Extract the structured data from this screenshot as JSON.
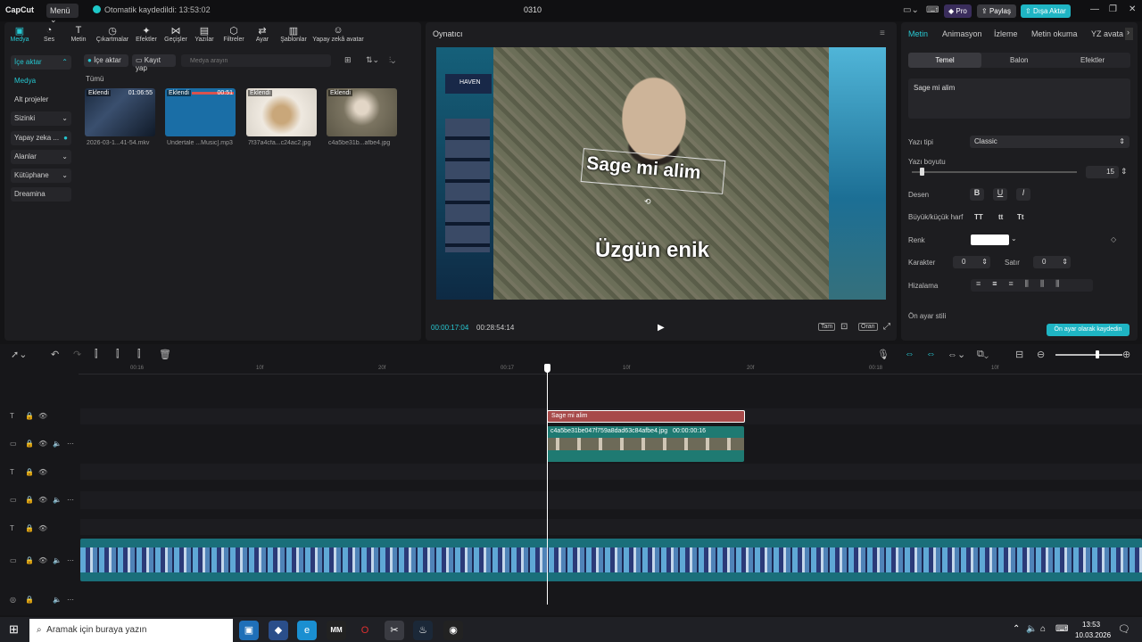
{
  "titlebar": {
    "app_name": "CapCut",
    "menu_label": "Menü",
    "autosave_text": "Otomatik kaydedildi: 13:53:02",
    "project_name": "0310",
    "pro_label": "Pro",
    "share_label": "Paylaş",
    "export_label": "Dışa Aktar"
  },
  "toolbar": {
    "items": [
      "Medya",
      "Ses",
      "Metin",
      "Çıkartmalar",
      "Efektler",
      "Geçişler",
      "Yazılar",
      "Filtreler",
      "Ayar",
      "Şablonlar",
      "Yapay zekâ avatar"
    ]
  },
  "sidebar": {
    "items": [
      "İçe aktar",
      "Medya",
      "Alt projeler",
      "Sizinki",
      "Yapay zeka ...",
      "Alanlar",
      "Kütüphane",
      "Dreamina"
    ]
  },
  "media": {
    "import_button": "İçe aktar",
    "record_button": "Kayıt yap",
    "search_placeholder": "Medya arayın",
    "filter_all": "Tümü",
    "cards": [
      {
        "badge": "Eklendi",
        "duration": "01:06:55",
        "name": "2026-03-1...41-54.mkv"
      },
      {
        "badge": "Eklendi",
        "duration": "00:51",
        "name": "Undertale ...Music].mp3"
      },
      {
        "badge": "Eklendi",
        "duration": "",
        "name": "7f37a4cfa...c24ac2.jpg"
      },
      {
        "badge": "Eklendi",
        "duration": "",
        "name": "c4a5be31b...afbe4.jpg"
      }
    ]
  },
  "player": {
    "title": "Oynatıcı",
    "caption_top": "Sage mi alim",
    "caption_bottom": "Üzgün enik",
    "overlay_brand": "HAVEN",
    "current_time": "00:00:17:04",
    "total_time": "00:28:54:14",
    "btn_full": "Tam",
    "btn_ratio": "Oran"
  },
  "right_panel": {
    "tabs": [
      "Metin",
      "Animasyon",
      "İzleme",
      "Metin okuma",
      "YZ avata"
    ],
    "subtabs": [
      "Temel",
      "Balon",
      "Efektler"
    ],
    "text_value": "Sage mi alim",
    "font_label": "Yazı tipi",
    "font_value": "Classic",
    "size_label": "Yazı boyutu",
    "size_value": "15",
    "size_fraction": 0.05,
    "pattern_label": "Desen",
    "case_label": "Büyük/küçük harf",
    "case_options": [
      "TT",
      "tt",
      "Tt"
    ],
    "color_label": "Renk",
    "color_value": "#ffffff",
    "char_label": "Karakter",
    "char_value": "0",
    "line_label": "Satır",
    "line_value": "0",
    "align_label": "Hizalama",
    "preset_label": "Ön ayar stili",
    "save_preset": "Ön ayar olarak kaydedin"
  },
  "timeline": {
    "ruler": [
      "00:16",
      "10f",
      "20f",
      "00:17",
      "10f",
      "20f",
      "00:18",
      "10f"
    ],
    "text_clip": "Sage mi alim",
    "image_clip_name": "c4a5be31be047f759a8dad63c84afbe4.jpg",
    "image_clip_duration": "00:00:00:16"
  },
  "taskbar": {
    "search_placeholder": "Aramak için buraya yazın",
    "time": "13:53",
    "date": "10.03.2026"
  },
  "colors": {
    "accent": "#28c8d2",
    "export_btn": "#1fb5c4",
    "text_clip": "#a74a4a",
    "image_clip": "#1f7a72",
    "video_track": "#1a6f7a"
  }
}
